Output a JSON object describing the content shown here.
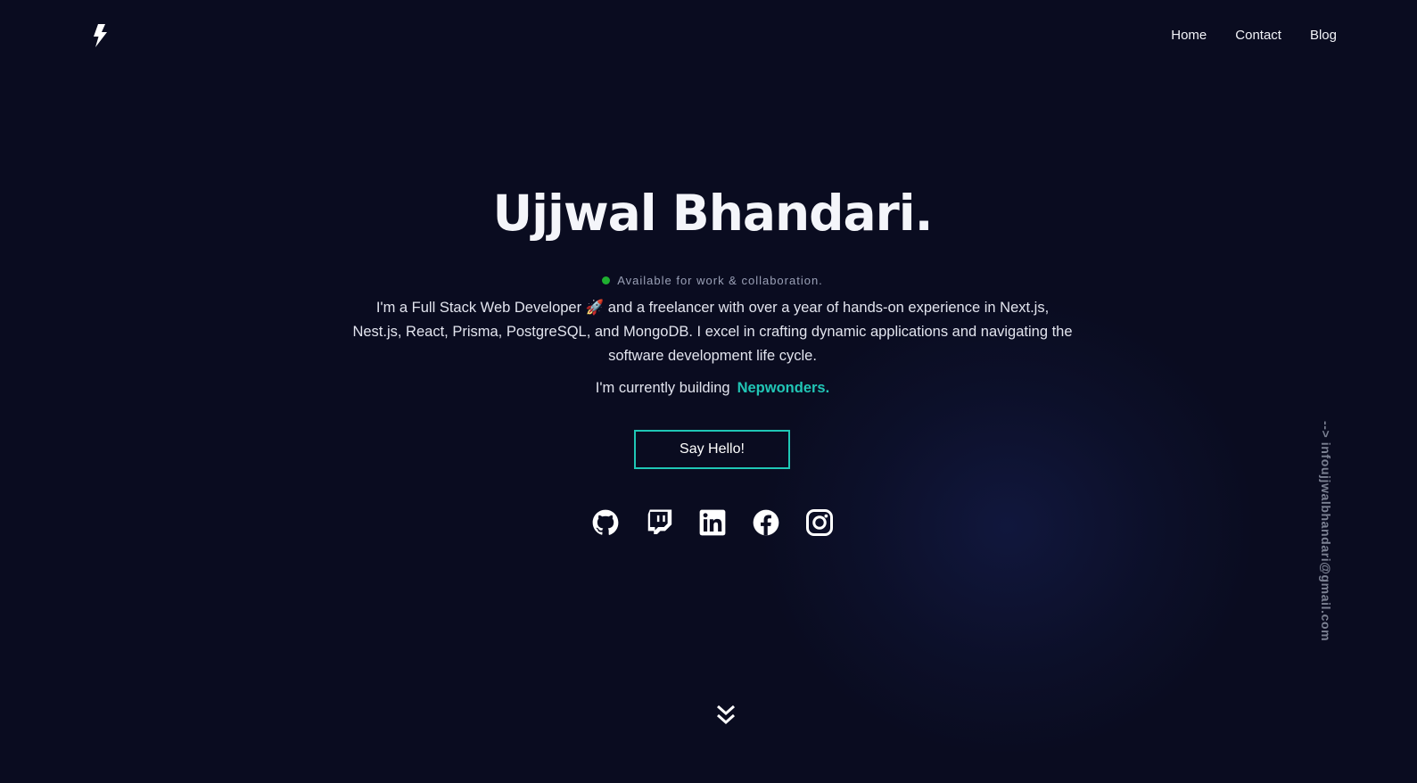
{
  "header": {
    "logo_icon": "lightning-bolt-icon",
    "nav": [
      {
        "label": "Home"
      },
      {
        "label": "Contact"
      },
      {
        "label": "Blog"
      }
    ]
  },
  "hero": {
    "name": "Ujjwal Bhandari.",
    "status_text": "Available for work & collaboration.",
    "status_color": "#1fb030",
    "bio": "I'm a Full Stack Web Developer 🚀 and a freelancer with over a year of hands-on experience in Next.js, Nest.js, React, Prisma, PostgreSQL, and MongoDB. I excel in crafting dynamic applications and navigating the software development life cycle.",
    "building_prefix": "I'm currently building",
    "building_link": "Nepwonders.",
    "cta_label": "Say Hello!",
    "accent_color": "#1fc7b5"
  },
  "socials": [
    {
      "icon": "github-icon"
    },
    {
      "icon": "twitch-icon"
    },
    {
      "icon": "linkedin-icon"
    },
    {
      "icon": "facebook-icon"
    },
    {
      "icon": "instagram-icon"
    }
  ],
  "sidebar": {
    "email_text": "--> infoujjwalbhandari@gmail.com"
  },
  "scroll_icon": "chevrons-down-icon"
}
